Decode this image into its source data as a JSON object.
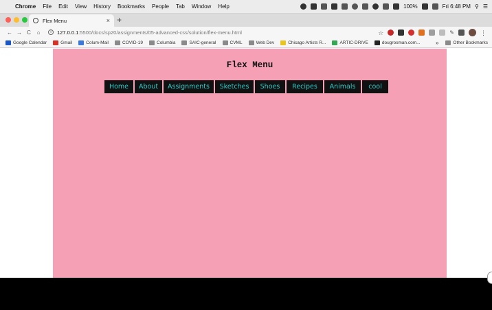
{
  "menubar": {
    "app": "Chrome",
    "items": [
      "File",
      "Edit",
      "View",
      "History",
      "Bookmarks",
      "People",
      "Tab",
      "Window",
      "Help"
    ],
    "battery": "100%",
    "datetime": "Fri 6:48 PM"
  },
  "tab": {
    "title": "Flex Menu",
    "close": "×",
    "new": "+"
  },
  "toolbar": {
    "back": "←",
    "forward": "→",
    "reload": "C",
    "home": "⌂",
    "url_host": "127.0.0.1",
    "url_path": ":5500/docs/sp20/assignments/05-advanced-css/solution/flex-menu.html"
  },
  "bookmarks": {
    "items": [
      {
        "label": "Google Calendar",
        "color": "#1a56c4"
      },
      {
        "label": "Gmail",
        "color": "#d93025"
      },
      {
        "label": "Colum-Mail",
        "color": "#3c78d8"
      },
      {
        "label": "COVID-19",
        "color": "#8a8a8a"
      },
      {
        "label": "Columbia",
        "color": "#8a8a8a"
      },
      {
        "label": "SAIC-general",
        "color": "#8a8a8a"
      },
      {
        "label": "CVML",
        "color": "#8a8a8a"
      },
      {
        "label": "Web Dev",
        "color": "#8a8a8a"
      },
      {
        "label": "Chicago Artists R...",
        "color": "#e8c520"
      },
      {
        "label": "ARTIC-DRIVE",
        "color": "#34a853"
      },
      {
        "label": "dougrosman.com...",
        "color": "#222222"
      }
    ],
    "more": "»",
    "other": "Other Bookmarks"
  },
  "page": {
    "title": "Flex Menu",
    "background": "#f5a0b4",
    "nav": [
      {
        "label": "Home",
        "w": 42
      },
      {
        "label": "About",
        "w": 40
      },
      {
        "label": "Assignments",
        "w": 73
      },
      {
        "label": "Sketches",
        "w": 56
      },
      {
        "label": "Shoes",
        "w": 44
      },
      {
        "label": "Recipes",
        "w": 53
      },
      {
        "label": "Animals",
        "w": 53
      },
      {
        "label": "cool",
        "w": 38
      }
    ]
  }
}
